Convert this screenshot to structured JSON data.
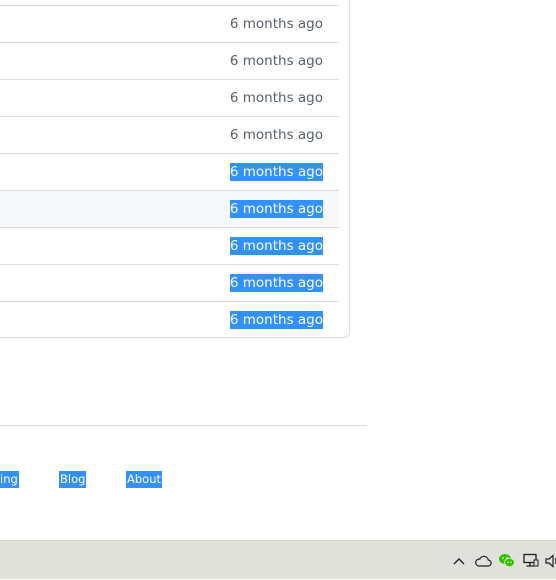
{
  "file_list": {
    "rows": [
      {
        "age": "6 months ago",
        "selected": false
      },
      {
        "age": "6 months ago",
        "selected": false
      },
      {
        "age": "6 months ago",
        "selected": false
      },
      {
        "age": "6 months ago",
        "selected": false
      },
      {
        "age": "6 months ago",
        "selected": true
      },
      {
        "age": "6 months ago",
        "selected": true
      },
      {
        "age": "6 months ago",
        "selected": true
      },
      {
        "age": "6 months ago",
        "selected": true
      },
      {
        "age": "6 months ago",
        "selected": true
      }
    ]
  },
  "footer": {
    "links": [
      "ing",
      "Blog",
      "About"
    ]
  },
  "taskbar": {
    "tray_icons": [
      "chevron-up-icon",
      "onedrive-cloud-icon",
      "wechat-icon",
      "network-icon",
      "volume-icon"
    ]
  },
  "colors": {
    "selection": "#3390ff",
    "muted_text": "#57606a",
    "border": "#d8dee4",
    "taskbar": "#dfe1da"
  }
}
